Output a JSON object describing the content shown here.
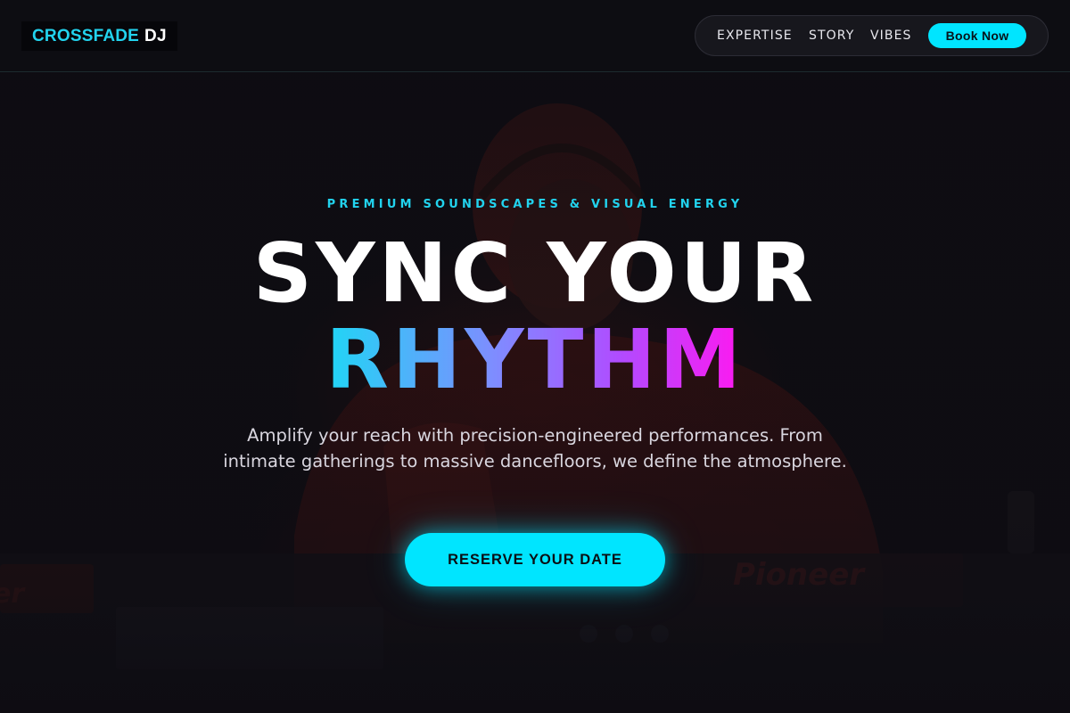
{
  "header": {
    "logo_primary": "CROSSFADE",
    "logo_secondary": "DJ",
    "nav": {
      "links": [
        "EXPERTISE",
        "STORY",
        "VIBES"
      ],
      "cta_label": "Book Now"
    }
  },
  "hero": {
    "background_image": "dj-with-headphones-at-pioneer-mixer",
    "eyebrow": "PREMIUM SOUNDSCAPES & VISUAL ENERGY",
    "headline_line1": "SYNC YOUR",
    "headline_line2": "RHYTHM",
    "description": "Amplify your reach with precision-engineered performances. From intimate gatherings to massive dancefloors, we define the atmosphere.",
    "cta_label": "RESERVE YOUR DATE"
  },
  "colors": {
    "accent_cyan": "#00e5ff",
    "gradient_start": "#1fd6f5",
    "gradient_mid": "#a05cff",
    "gradient_end": "#ff18f0",
    "background": "#0d0c12"
  }
}
